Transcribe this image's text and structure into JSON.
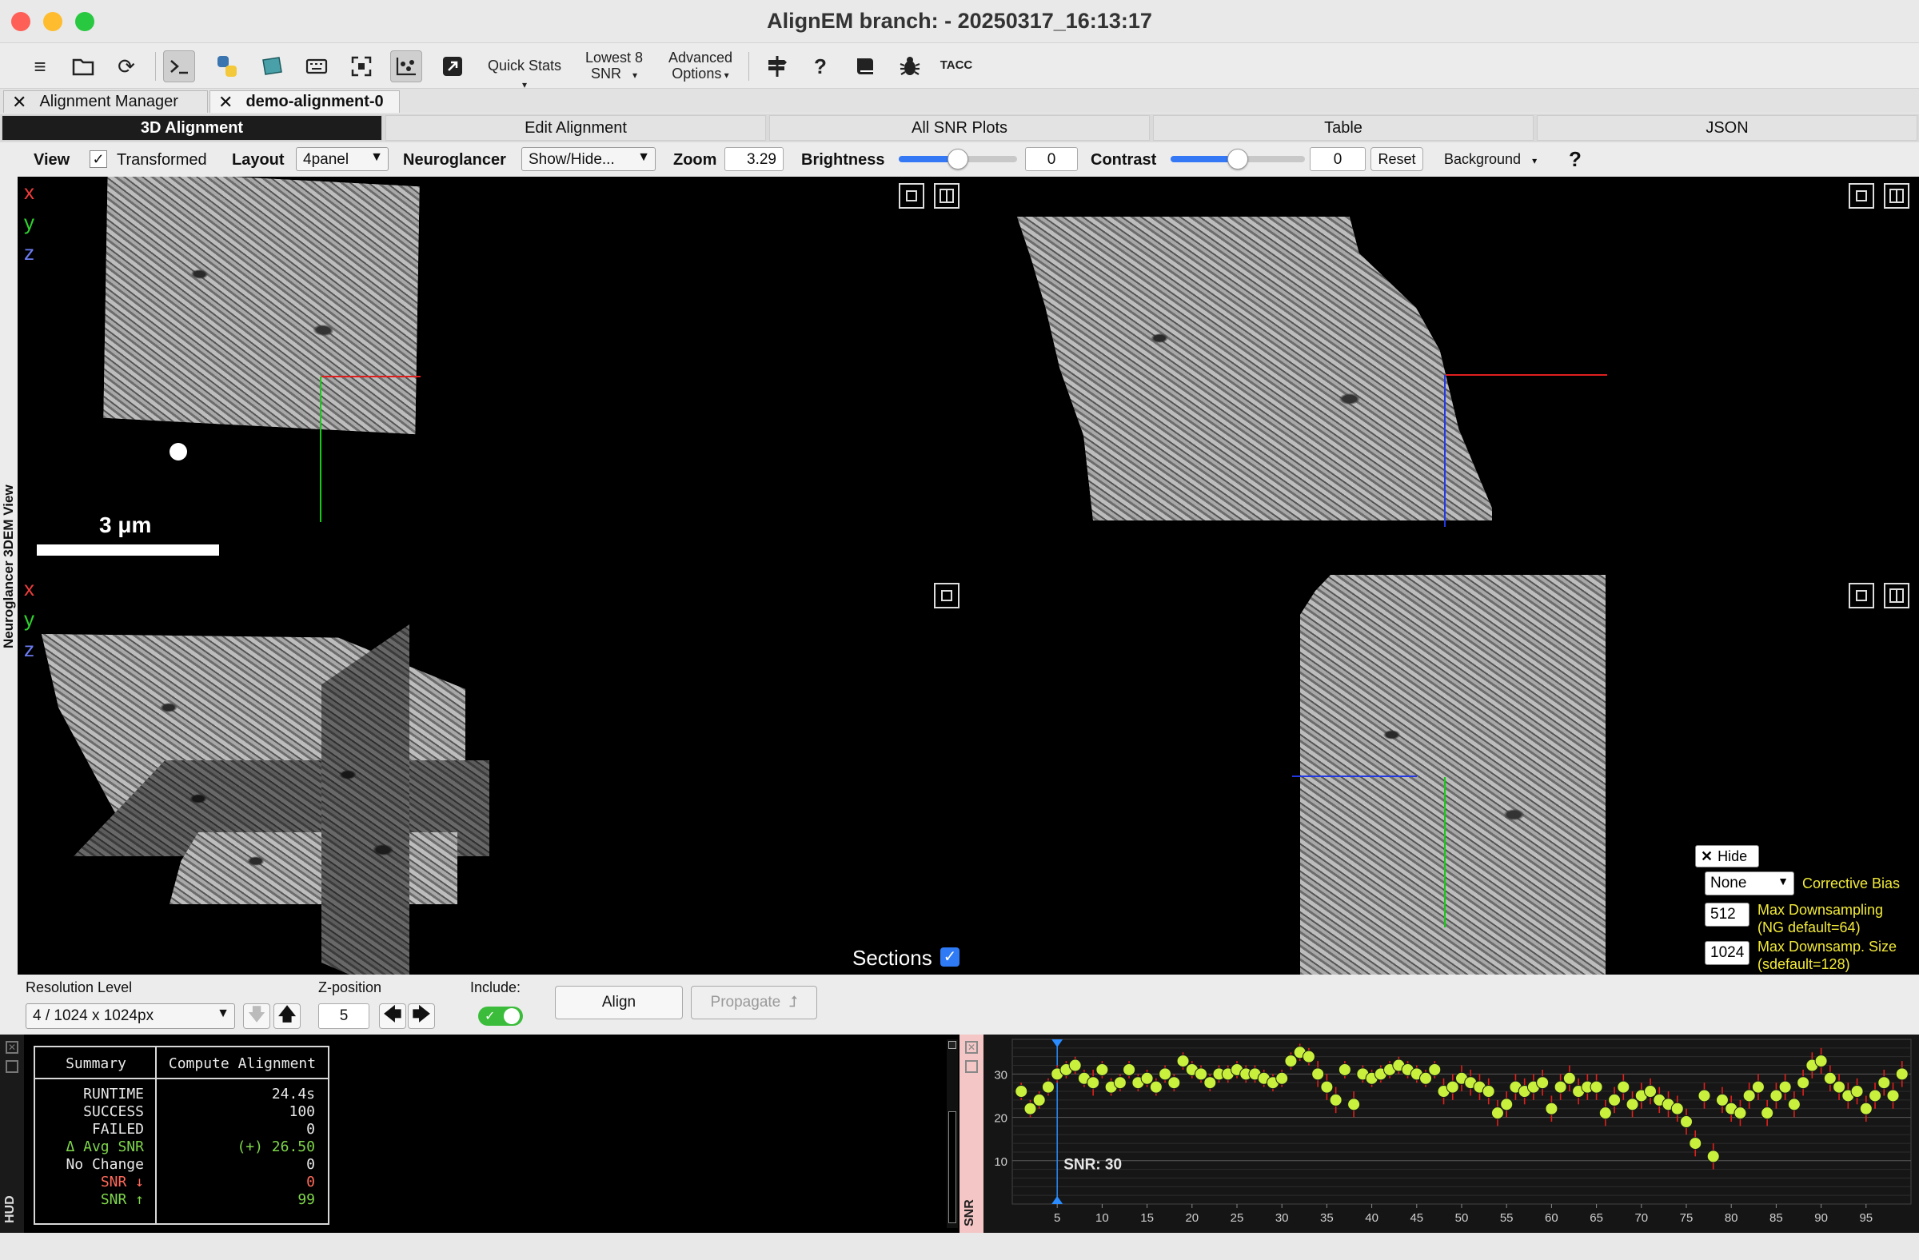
{
  "window": {
    "title": "AlignEM branch:  - 20250317_16:13:17"
  },
  "toolbar": {
    "icons": [
      "menu-icon",
      "folder-icon",
      "refresh-icon",
      "terminal-icon",
      "python-icon",
      "notebook-icon",
      "keyboard-icon",
      "fullscreen-icon",
      "scatter-icon",
      "external-icon",
      "signpost-icon",
      "help-icon",
      "book-icon",
      "bug-icon",
      "tacc-icon"
    ],
    "quick_stats": "Quick Stats",
    "lowest_snr_line1": "Lowest 8",
    "lowest_snr_line2": "SNR",
    "advanced_line1": "Advanced",
    "advanced_line2": "Options",
    "tacc": "TACC"
  },
  "doc_tabs": [
    {
      "label": "Alignment Manager",
      "active": false
    },
    {
      "label": "demo-alignment-0",
      "active": true
    }
  ],
  "main_tabs": [
    {
      "label": "3D Alignment",
      "active": true
    },
    {
      "label": "Edit Alignment",
      "active": false
    },
    {
      "label": "All SNR Plots",
      "active": false
    },
    {
      "label": "Table",
      "active": false
    },
    {
      "label": "JSON",
      "active": false
    }
  ],
  "controls": {
    "view_label": "View",
    "transformed_label": "Transformed",
    "transformed_checked": true,
    "layout_label": "Layout",
    "layout_value": "4panel",
    "neuroglancer_label": "Neuroglancer",
    "neuroglancer_value": "Show/Hide...",
    "zoom_label": "Zoom",
    "zoom_value": "3.29",
    "brightness_label": "Brightness",
    "brightness_value": "0",
    "brightness_level": 0.5,
    "contrast_label": "Contrast",
    "contrast_value": "0",
    "contrast_level": 0.5,
    "reset_label": "Reset",
    "background_label": "Background",
    "help": "?"
  },
  "viewer": {
    "side_label": "Neuroglancer 3DEM View",
    "axis_x": "x",
    "axis_y": "y",
    "axis_z": "z",
    "scale_bar": "3 μm",
    "sections_label": "Sections",
    "sections_checked": true,
    "hide_label": "Hide",
    "bias_value": "None",
    "bias_label": "Corrective Bias",
    "max_downsampling_value": "512",
    "max_downsampling_label1": "Max Downsampling",
    "max_downsampling_label2": "(NG default=64)",
    "max_downsamp_size_value": "1024",
    "max_downsamp_size_label1": "Max Downsamp. Size",
    "max_downsamp_size_label2": "(sdefault=128)"
  },
  "bottom": {
    "resolution_label": "Resolution Level",
    "resolution_value": "4 / 1024 x 1024px",
    "zpos_label": "Z-position",
    "zpos_value": "5",
    "include_label": "Include:",
    "include_on": true,
    "align_label": "Align",
    "propagate_label": "Propagate"
  },
  "hud": {
    "side_label": "HUD",
    "col1": "Summary",
    "col2": "Compute Alignment",
    "rows": [
      {
        "k": "RUNTIME",
        "v": "24.4s",
        "color": "#e8e8e8"
      },
      {
        "k": "SUCCESS",
        "v": "100",
        "color": "#e8e8e8"
      },
      {
        "k": "FAILED",
        "v": "0",
        "color": "#e8e8e8"
      },
      {
        "k": "Δ Avg SNR",
        "v": "(+) 26.50",
        "color": "#7fd64a"
      },
      {
        "k": "No Change",
        "v": "0",
        "color": "#e8e8e8"
      },
      {
        "k": "SNR ↓",
        "v": "0",
        "color": "#ff6b5b"
      },
      {
        "k": "SNR ↑",
        "v": "99",
        "color": "#7fd64a"
      }
    ]
  },
  "snr_plot": {
    "side_label": "SNR",
    "readout": "SNR: 30",
    "colors": {
      "point": "#c8f03c",
      "error": "#e0201a",
      "cursor": "#2a8cff"
    }
  },
  "chart_data": {
    "type": "scatter",
    "title": "",
    "xlabel": "",
    "ylabel": "SNR",
    "xlim": [
      0,
      100
    ],
    "ylim": [
      0,
      38
    ],
    "x_ticks": [
      5,
      10,
      15,
      20,
      25,
      30,
      35,
      40,
      45,
      50,
      55,
      60,
      65,
      70,
      75,
      80,
      85,
      90,
      95
    ],
    "y_ticks": [
      10,
      20,
      30
    ],
    "cursor_x": 5,
    "x": [
      1,
      2,
      3,
      4,
      5,
      6,
      7,
      8,
      9,
      10,
      11,
      12,
      13,
      14,
      15,
      16,
      17,
      18,
      19,
      20,
      21,
      22,
      23,
      24,
      25,
      26,
      27,
      28,
      29,
      30,
      31,
      32,
      33,
      34,
      35,
      36,
      37,
      38,
      39,
      40,
      41,
      42,
      43,
      44,
      45,
      46,
      47,
      48,
      49,
      50,
      51,
      52,
      53,
      54,
      55,
      56,
      57,
      58,
      59,
      60,
      61,
      62,
      63,
      64,
      65,
      66,
      67,
      68,
      69,
      70,
      71,
      72,
      73,
      74,
      75,
      76,
      77,
      78,
      79,
      80,
      81,
      82,
      83,
      84,
      85,
      86,
      87,
      88,
      89,
      90,
      91,
      92,
      93,
      94,
      95,
      96,
      97,
      98,
      99
    ],
    "y": [
      26,
      22,
      24,
      27,
      30,
      31,
      32,
      29,
      28,
      31,
      27,
      28,
      31,
      28,
      29,
      27,
      30,
      28,
      33,
      31,
      30,
      28,
      30,
      30,
      31,
      30,
      30,
      29,
      28,
      29,
      33,
      35,
      34,
      30,
      27,
      24,
      31,
      23,
      30,
      29,
      30,
      31,
      32,
      31,
      30,
      29,
      31,
      26,
      27,
      29,
      28,
      27,
      26,
      21,
      23,
      27,
      26,
      27,
      28,
      22,
      27,
      29,
      26,
      27,
      27,
      21,
      24,
      27,
      23,
      25,
      26,
      24,
      23,
      22,
      19,
      14,
      25,
      11,
      24,
      22,
      21,
      25,
      27,
      21,
      25,
      27,
      23,
      28,
      32,
      33,
      29,
      27,
      25,
      26,
      22,
      25,
      28,
      25,
      30
    ],
    "err": [
      2,
      2,
      2,
      2,
      2,
      2,
      2,
      2,
      3,
      2,
      2,
      2,
      2,
      2,
      2,
      2,
      2,
      2,
      2,
      2,
      2,
      2,
      2,
      2,
      2,
      2,
      2,
      2,
      2,
      2,
      2,
      2,
      2,
      3,
      3,
      3,
      2,
      3,
      2,
      2,
      2,
      2,
      2,
      2,
      2,
      2,
      2,
      3,
      3,
      3,
      3,
      3,
      3,
      3,
      3,
      3,
      3,
      3,
      3,
      3,
      3,
      3,
      3,
      3,
      3,
      3,
      3,
      3,
      3,
      3,
      3,
      3,
      3,
      3,
      3,
      3,
      3,
      3,
      3,
      3,
      3,
      3,
      3,
      3,
      3,
      3,
      3,
      3,
      3,
      3,
      3,
      3,
      3,
      3,
      3,
      3,
      3,
      3,
      3
    ]
  }
}
